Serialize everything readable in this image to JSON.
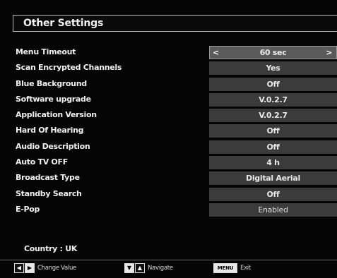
{
  "title": "Other Settings",
  "settings": [
    {
      "label": "Menu Timeout",
      "value": "60 sec"
    },
    {
      "label": "Scan Encrypted Channels",
      "value": "Yes"
    },
    {
      "label": "Blue Background",
      "value": "Off"
    },
    {
      "label": "Software upgrade",
      "value": "V.0.2.7"
    },
    {
      "label": "Application Version",
      "value": "V.0.2.7"
    },
    {
      "label": "Hard Of Hearing",
      "value": "Off"
    },
    {
      "label": "Audio Description",
      "value": "Off"
    },
    {
      "label": "Auto TV OFF",
      "value": "4 h"
    },
    {
      "label": "Broadcast Type",
      "value": "Digital Aerial"
    },
    {
      "label": "Standby Search",
      "value": "Off"
    },
    {
      "label": "E-Pop",
      "value": "Enabled"
    }
  ],
  "selected_arrows": {
    "left": "<",
    "right": ">"
  },
  "country": "Country : UK",
  "footer": {
    "change_value": "Change Value",
    "navigate": "Navigate",
    "menu_key": "MENU",
    "exit": "Exit"
  }
}
